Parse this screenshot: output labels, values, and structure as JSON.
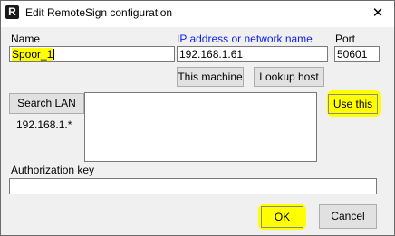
{
  "window": {
    "app_icon_letter": "R",
    "title": "Edit RemoteSign configuration"
  },
  "fields": {
    "name_label": "Name",
    "name_value": "Spoor_1",
    "ip_label": "IP address or network name",
    "ip_value": "192.168.1.61",
    "port_label": "Port",
    "port_value": "50601",
    "auth_label": "Authorization key",
    "auth_value": ""
  },
  "buttons": {
    "this_machine": "This machine",
    "lookup_host": "Lookup host",
    "search_lan": "Search LAN",
    "use_this": "Use this",
    "ok": "OK",
    "cancel": "Cancel"
  },
  "lan": {
    "subnet": "192.168.1.*",
    "results": []
  },
  "colors": {
    "highlight": "#ffff00",
    "label_blue": "#0a1ef0",
    "background": "#f0f0f0"
  }
}
